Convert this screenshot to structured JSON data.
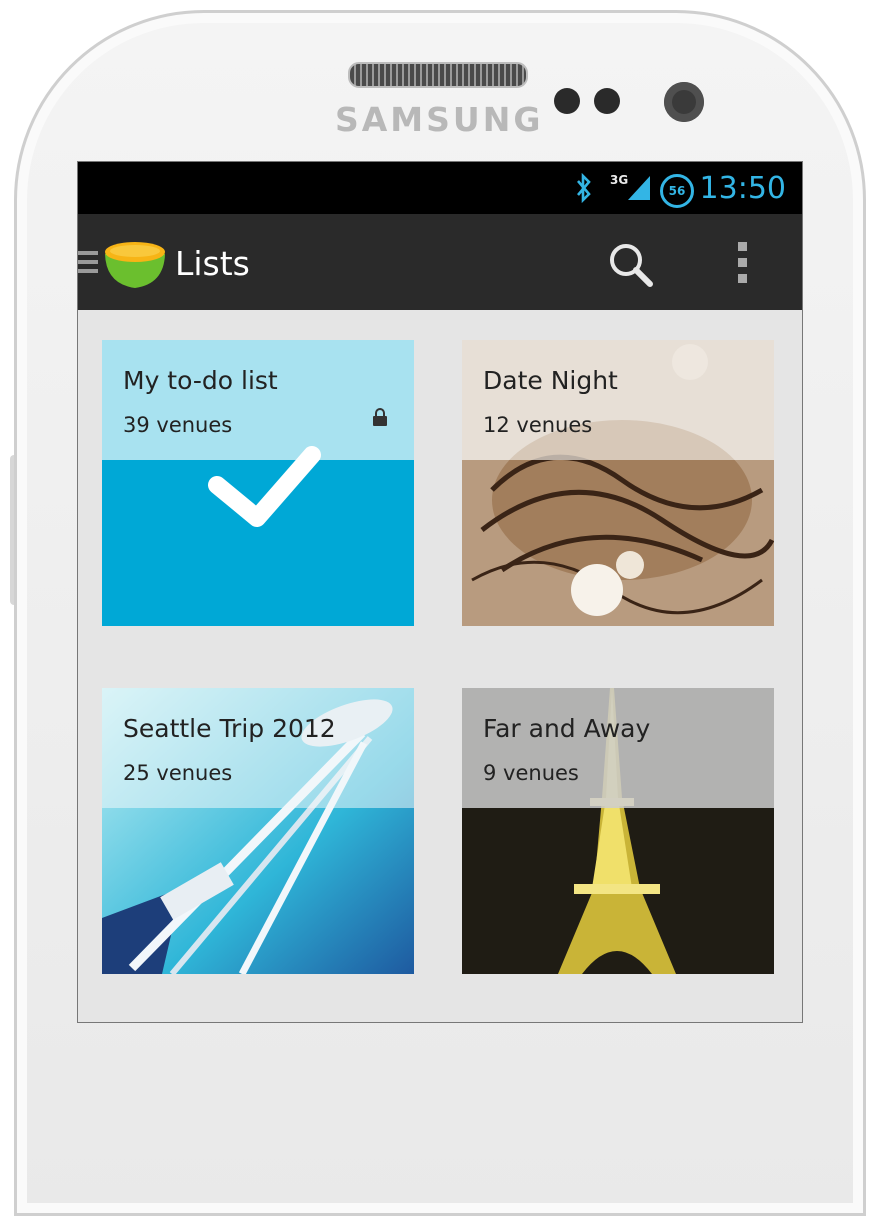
{
  "device": {
    "brand": "SAMSUNG"
  },
  "status_bar": {
    "network": "3G",
    "battery": "56",
    "time": "13:50"
  },
  "action_bar": {
    "title": "Lists",
    "icons": [
      "menu-icon",
      "app-bowl-logo",
      "search-icon",
      "overflow-menu-icon"
    ]
  },
  "lists": [
    {
      "title": "My to-do list",
      "count": "39 venues",
      "locked": true
    },
    {
      "title": "Date Night",
      "count": "12 venues"
    },
    {
      "title": "Seattle Trip 2012",
      "count": "25 venues"
    },
    {
      "title": "Far and Away",
      "count": "9 venues"
    }
  ],
  "colors": {
    "accent": "#33b5e5",
    "todo_top": "#a8e2f0",
    "todo_bottom": "#00a8d6",
    "action_bar": "#2a2a2a"
  }
}
